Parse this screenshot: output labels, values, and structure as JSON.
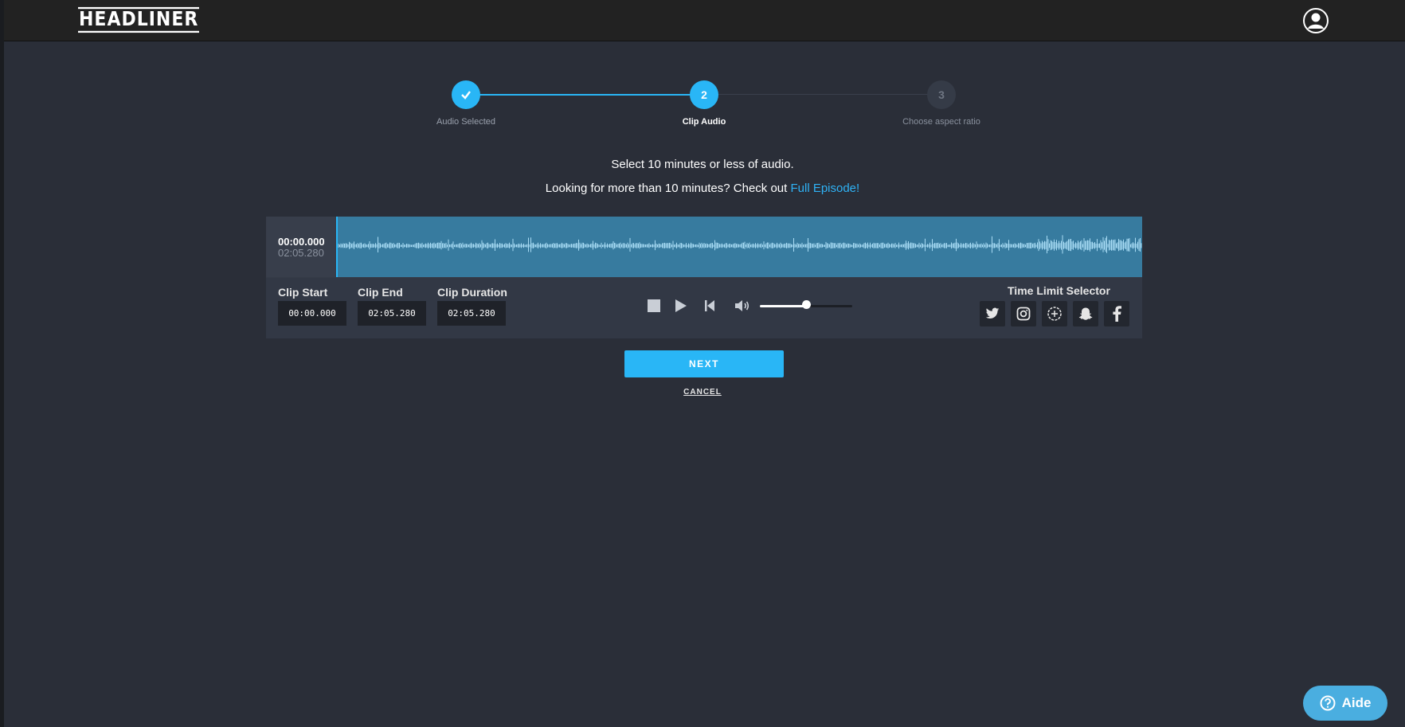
{
  "header": {
    "logo": "HEADLINER"
  },
  "stepper": {
    "steps": [
      {
        "label": "Audio Selected",
        "number": "",
        "state": "done"
      },
      {
        "label": "Clip Audio",
        "number": "2",
        "state": "active"
      },
      {
        "label": "Choose aspect ratio",
        "number": "3",
        "state": "pending"
      }
    ]
  },
  "messages": {
    "line1": "Select 10 minutes or less of audio.",
    "line2_prefix": "Looking for more than 10 minutes? Check out ",
    "line2_link": "Full Episode!"
  },
  "waveform": {
    "current_time": "00:00.000",
    "total_time": "02:05.280"
  },
  "clip": {
    "start_label": "Clip Start",
    "start_value": "00:00.000",
    "end_label": "Clip End",
    "end_value": "02:05.280",
    "duration_label": "Clip Duration",
    "duration_value": "02:05.280"
  },
  "player": {
    "volume": 0.5
  },
  "time_limit": {
    "label": "Time Limit Selector",
    "platforms": [
      "twitter-icon",
      "instagram-icon",
      "custom-icon",
      "snapchat-icon",
      "facebook-icon"
    ]
  },
  "actions": {
    "next_label": "NEXT",
    "cancel_label": "CANCEL"
  },
  "help": {
    "label": "Aide"
  },
  "colors": {
    "accent": "#29b6f6",
    "background": "#2a2e38",
    "waveform": "#377b9f"
  }
}
